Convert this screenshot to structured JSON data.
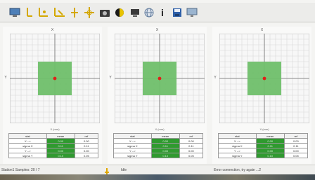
{
  "toolbar": {
    "icons": [
      "monitor-icon",
      "y-axis-icon",
      "y-axis-pair-icon",
      "y-axis-triple-icon",
      "cursor-icon",
      "crosshair-icon",
      "camera-icon",
      "half-circle-icon",
      "monitor-small-icon",
      "globe-icon",
      "info-icon",
      "save-icon",
      "screen-icon"
    ],
    "info_label": "i"
  },
  "panels": [
    {
      "title": "X",
      "ylabel": "Y",
      "xlabel": "X (mm)"
    },
    {
      "title": "X",
      "ylabel": "Y",
      "xlabel": "X (mm)"
    },
    {
      "title": "X",
      "ylabel": "Y",
      "xlabel": "X (mm)"
    }
  ],
  "stats": {
    "headers": [
      "stat",
      "mean",
      "ref"
    ],
    "rows": [
      [
        "X -->",
        "0.00",
        "0.00"
      ],
      [
        "sigma X",
        "0.11",
        "0.11"
      ],
      [
        "Y -->",
        "0.00",
        "0.00"
      ],
      [
        "sigma Y",
        "0.10",
        "0.05"
      ]
    ]
  },
  "status": {
    "left": "Station1 Samples: 20 / 7",
    "mid": "Idle",
    "right": "Error connection, try again ...2"
  },
  "colors": {
    "accent_green": "#2f9a2f",
    "plot_green": "#6fbf6a",
    "target_red": "#e0201a"
  }
}
